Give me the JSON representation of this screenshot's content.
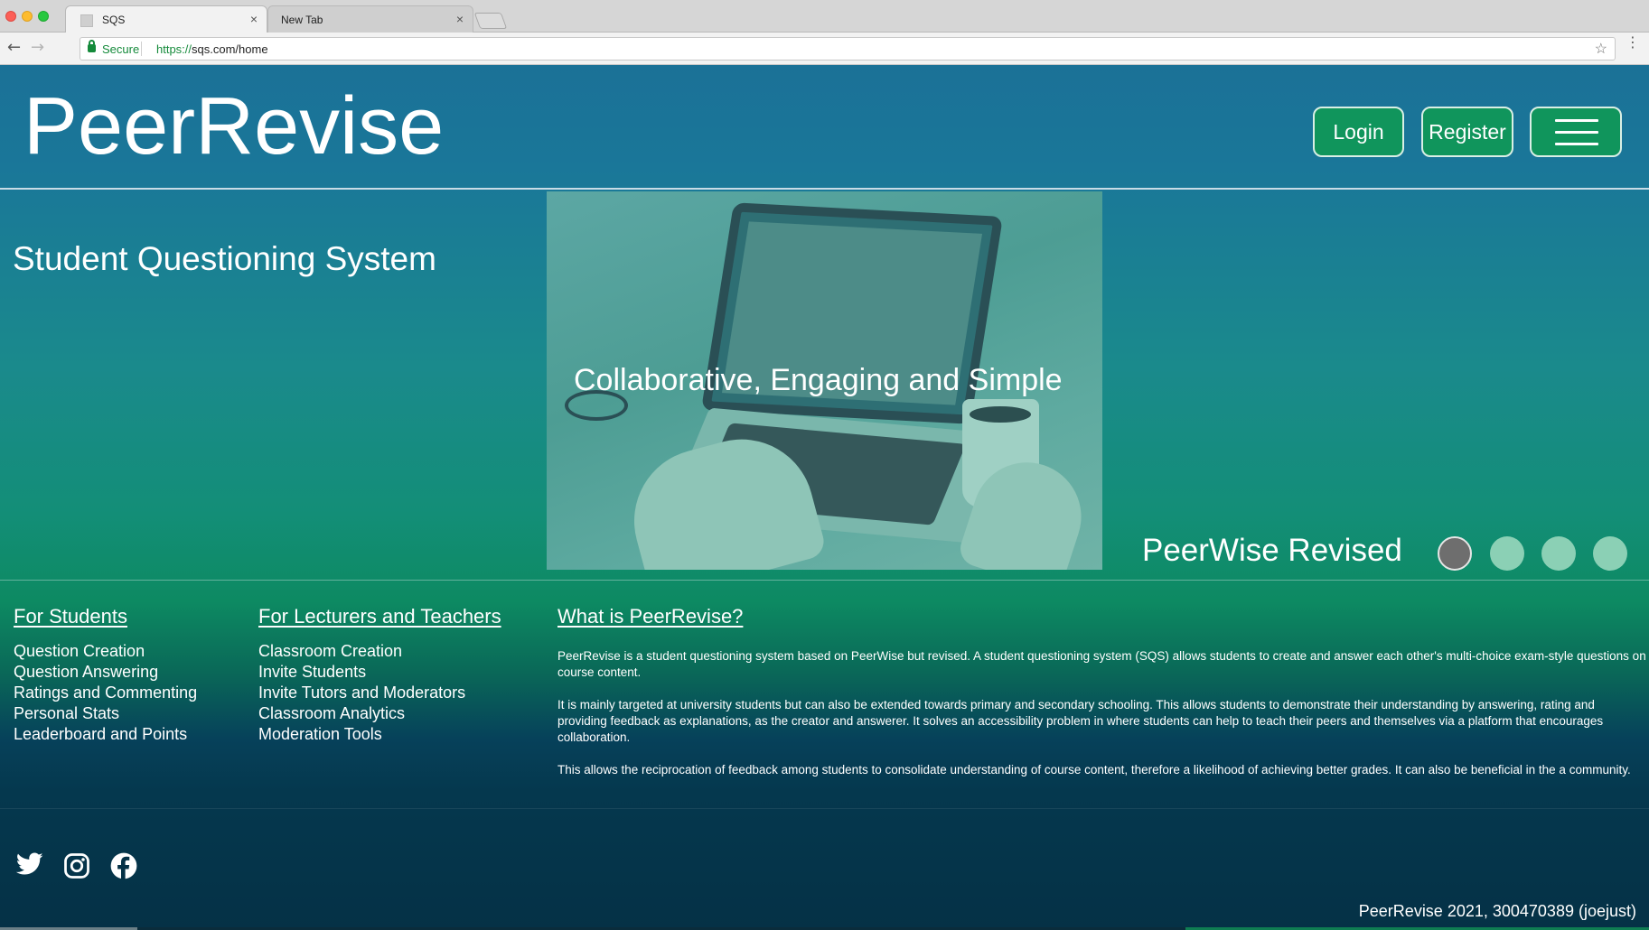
{
  "browser": {
    "tabs": [
      {
        "title": "SQS",
        "active": true
      },
      {
        "title": "New Tab",
        "active": false
      }
    ],
    "close_glyph": "×",
    "security_label": "Secure",
    "url_scheme": "https://",
    "url_rest": "sqs.com/home"
  },
  "header": {
    "logo": "PeerRevise",
    "login_label": "Login",
    "register_label": "Register"
  },
  "hero": {
    "title": "Student Questioning System",
    "caption": "Collaborative, Engaging and Simple",
    "tagline": "PeerWise Revised",
    "carousel_count": 4,
    "carousel_active": 1
  },
  "students": {
    "heading": "For Students",
    "items": [
      "Question Creation",
      "Question Answering",
      "Ratings and Commenting",
      "Personal Stats",
      "Leaderboard and Points"
    ]
  },
  "lecturers": {
    "heading": "For Lecturers and Teachers",
    "items": [
      "Classroom Creation",
      "Invite Students",
      "Invite Tutors and Moderators",
      "Classroom Analytics",
      "Moderation Tools"
    ]
  },
  "about": {
    "heading": "What is PeerRevise?",
    "paragraphs": [
      "PeerRevise is a student questioning system based on PeerWise but revised. A student questioning system (SQS) allows students to create and answer each other's multi-choice exam-style questions on course content.",
      "It is mainly targeted at university students but can also be extended towards primary and secondary schooling. This allows students to demonstrate their understanding by answering, rating and providing feedback as explanations, as the creator and answerer. It solves an accessibility problem in where students can help to teach their peers and themselves via a platform that encourages collaboration.",
      "This allows the reciprocation of feedback among students to consolidate understanding of course content, therefore a likelihood of achieving better grades. It can also be beneficial in the a community."
    ]
  },
  "footer": {
    "copyright": "PeerRevise 2021, 300470389 (joejust)",
    "social_icons": [
      "twitter-icon",
      "instagram-icon",
      "facebook-icon"
    ]
  },
  "colors": {
    "brand_green": "#10955c",
    "header_blue": "#1b7197",
    "footer_navy": "#053146"
  }
}
